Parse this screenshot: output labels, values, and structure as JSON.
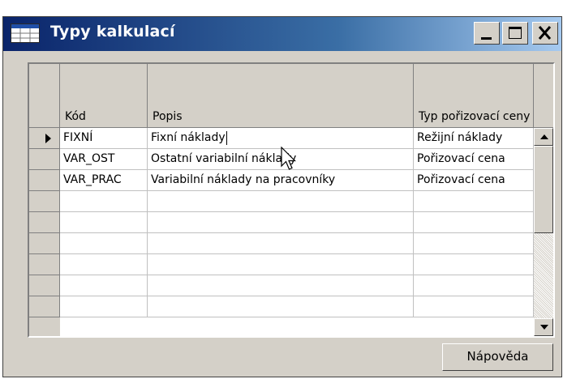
{
  "window": {
    "title": "Typy kalkulací",
    "controls": {
      "minimize": "minimize",
      "maximize": "maximize",
      "close": "close"
    }
  },
  "table": {
    "headers": {
      "kod": "Kód",
      "popis": "Popis",
      "typ": "Typ pořizovací ceny"
    },
    "rows": [
      {
        "kod": "FIXNÍ",
        "popis": "Fixní náklady",
        "typ": "Režijní náklady",
        "current": true
      },
      {
        "kod": "VAR_OST",
        "popis": "Ostatní variabilní náklady",
        "typ": "Pořizovací cena"
      },
      {
        "kod": "VAR_PRAC",
        "popis": "Variabilní náklady na pracovníky",
        "typ": "Pořizovací cena"
      }
    ],
    "empty_rows": 6
  },
  "footer": {
    "help_label": "Nápověda"
  },
  "colors": {
    "titlebar_start": "#0a246a",
    "titlebar_end": "#a6caf0",
    "face": "#d4d0c8"
  }
}
